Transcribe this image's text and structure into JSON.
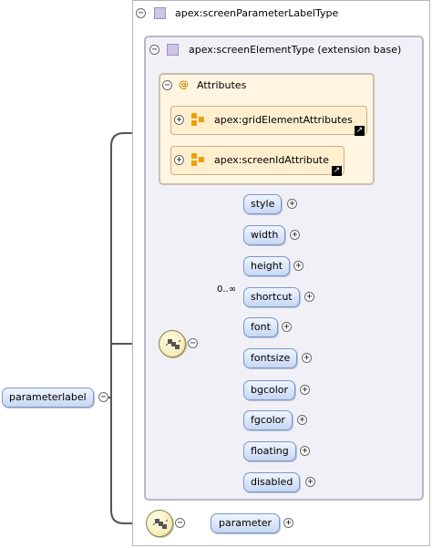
{
  "root_element": {
    "name": "parameterlabel"
  },
  "complex_type": {
    "name": "apex:screenParameterLabelType"
  },
  "extension": {
    "name": "apex:screenElementType (extension base)"
  },
  "attributes": {
    "title": "Attributes",
    "at_icon": "@",
    "groups": [
      {
        "name": "apex:gridElementAttributes",
        "icon": "attribute-group-icon"
      },
      {
        "name": "apex:screenIdAttribute",
        "icon": "attribute-group-icon"
      }
    ]
  },
  "sequence_elements": [
    {
      "name": "style"
    },
    {
      "name": "width"
    },
    {
      "name": "height"
    },
    {
      "name": "shortcut",
      "occurrence": "0..∞"
    },
    {
      "name": "font"
    },
    {
      "name": "fontsize"
    },
    {
      "name": "bgcolor"
    },
    {
      "name": "fgcolor"
    },
    {
      "name": "floating"
    },
    {
      "name": "disabled"
    }
  ],
  "outer_sequence_elements": [
    {
      "name": "parameter"
    }
  ],
  "symbols": {
    "expand": "+",
    "collapse": "−",
    "link": "↗"
  },
  "colors": {
    "element_fill": "#c6d7f2",
    "element_border": "#7e97c4",
    "extension_fill": "#f1f0f7",
    "attributes_fill": "#fff5e1",
    "connector": "#555555"
  }
}
